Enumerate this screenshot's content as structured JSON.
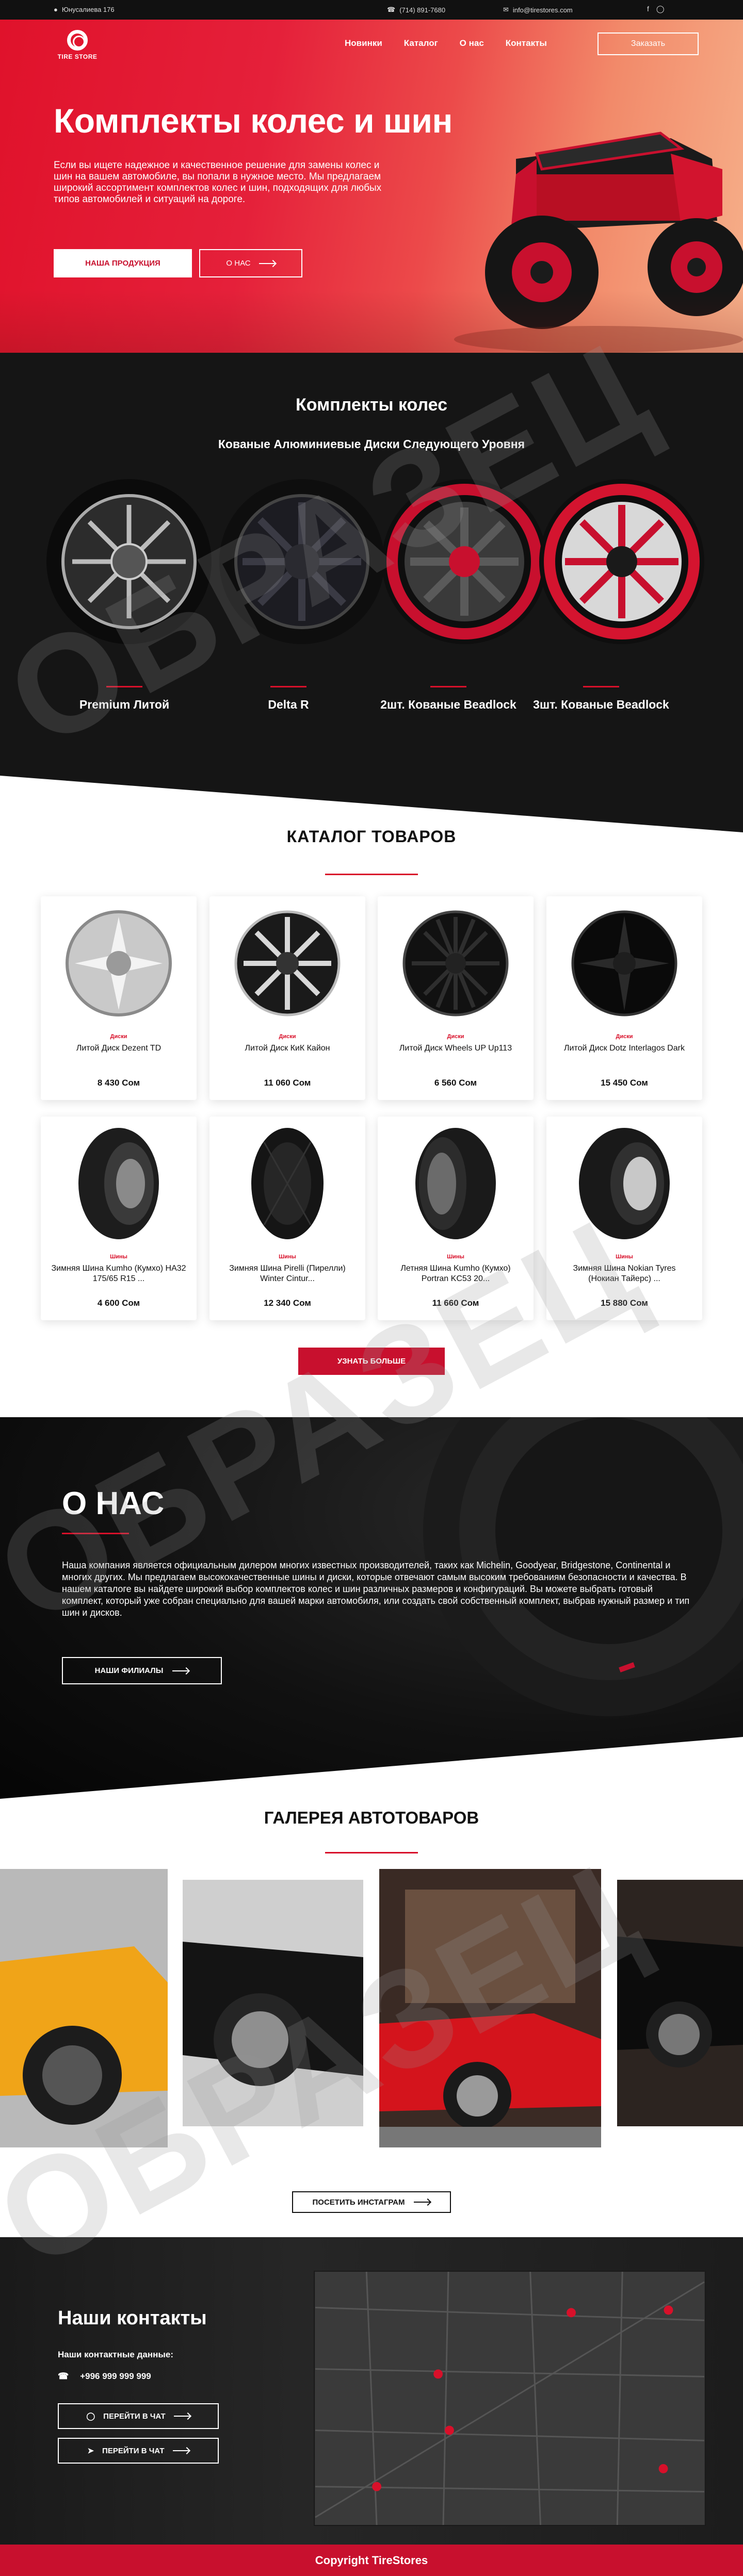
{
  "topbar": {
    "address": "Юнусалиева 176",
    "phone": "(714) 891-7680",
    "email": "info@tirestores.com"
  },
  "header": {
    "logo_text": "TIRE STORE",
    "nav": [
      "Новинки",
      "Каталог",
      "О нас",
      "Контакты"
    ],
    "order_label": "Заказать"
  },
  "hero": {
    "title": "Комплекты колес и шин",
    "text": "Если вы ищете надежное и качественное решение для замены колес и шин на вашем автомобиле, вы попали в нужное место. Мы предлагаем широкий ассортимент комплектов колес и шин, подходящих для любых типов автомобилей и ситуаций на дороге.",
    "products_label": "НАША ПРОДУКЦИЯ",
    "about_label": "О НАС"
  },
  "kits": {
    "title": "Комплекты колес",
    "subtitle": "Кованые Алюминиевые Диски Следующего Уровня",
    "items": [
      "Premium Литой",
      "Delta R",
      "2шт. Кованые Beadlock",
      "3шт. Кованые Beadlock"
    ]
  },
  "catalog": {
    "title": "КАТАЛОГ ТОВАРОВ",
    "products": [
      {
        "category": "Диски",
        "name": "Литой Диск Dezent TD",
        "price": "8 430 Сом"
      },
      {
        "category": "Диски",
        "name": "Литой Диск КиК Кайон",
        "price": "11 060 Сом"
      },
      {
        "category": "Диски",
        "name": "Литой Диск Wheels UP Up113",
        "price": "6 560 Сом"
      },
      {
        "category": "Диски",
        "name": "Литой Диск Dotz Interlagos Dark",
        "price": "15 450 Сом"
      },
      {
        "category": "Шины",
        "name": "Зимняя Шина Kumho (Кумхо) HA32 175/65 R15 ...",
        "price": "4 600 Сом"
      },
      {
        "category": "Шины",
        "name": "Зимняя Шина Pirelli (Пирелли) Winter Cintur...",
        "price": "12 340 Сом"
      },
      {
        "category": "Шины",
        "name": "Летняя Шина Kumho (Кумхо) Portran KC53 20...",
        "price": "11 660 Сом"
      },
      {
        "category": "Шины",
        "name": "Зимняя Шина Nokian Tyres (Нокиан Тайерс) ...",
        "price": "15 880 Сом"
      }
    ],
    "more_label": "УЗНАТЬ БОЛЬШЕ"
  },
  "about": {
    "title": "О НАС",
    "text": "Наша компания является официальным дилером многих известных производителей, таких как Michelin, Goodyear, Bridgestone, Continental и многих других. Мы предлагаем высококачественные шины и диски, которые отвечают самым высоким требованиям безопасности и качества. В нашем каталоге вы найдете широкий выбор комплектов колес и шин различных размеров и конфигураций. Вы можете выбрать готовый комплект, который уже собран специально для вашей марки автомобиля, или создать свой собственный комплект, выбрав нужный размер и тип шин и дисков.",
    "branches_label": "НАШИ ФИЛИАЛЫ"
  },
  "gallery": {
    "title": "ГАЛЕРЕЯ АВТОТОВАРОВ",
    "instagram_label": "ПОСЕТИТЬ ИНСТАГРАМ"
  },
  "contacts": {
    "title": "Наши контакты",
    "subtitle": "Наши контактные данные:",
    "phone": "+996 999 999 999",
    "chat1_label": "ПЕРЕЙТИ В ЧАТ",
    "chat2_label": "ПЕРЕЙТИ В ЧАТ"
  },
  "footer": {
    "copyright": "Copyright TireStores"
  },
  "watermark": "ОБРАЗЕЦ",
  "colors": {
    "accent": "#c8102e",
    "dark": "#151515"
  }
}
